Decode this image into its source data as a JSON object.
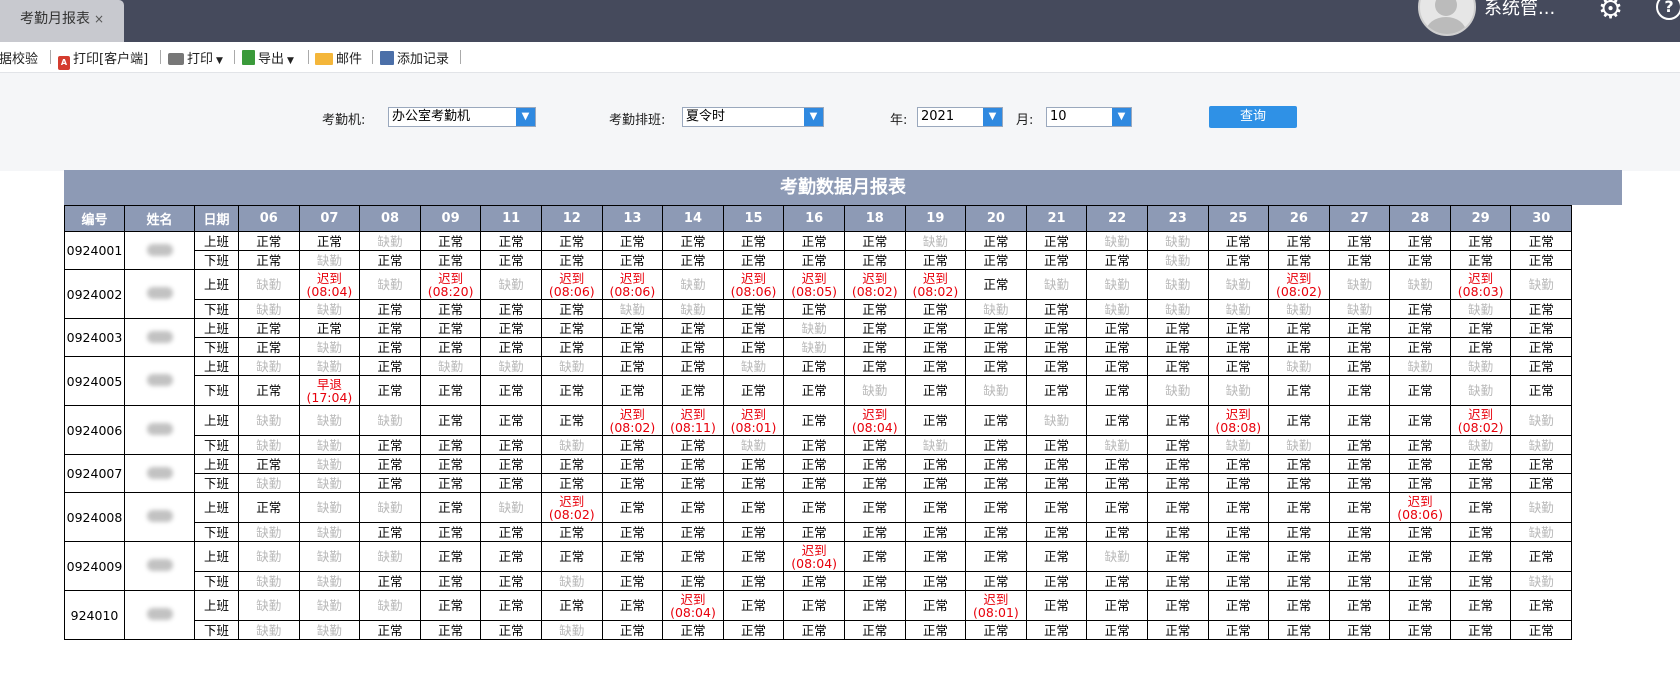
{
  "tab": {
    "title": "考勤月报表",
    "close": "×"
  },
  "user": {
    "name": "系统管..."
  },
  "toolbar": {
    "items": [
      "数据校验",
      "打印[客户端]",
      "打印",
      "导出",
      "邮件",
      "添加记录"
    ]
  },
  "filters": {
    "machine_label": "考勤机:",
    "machine_value": "办公室考勤机",
    "shift_label": "考勤排班:",
    "shift_value": "夏令时",
    "year_label": "年:",
    "year_value": "2021",
    "month_label": "月:",
    "month_value": "10",
    "query_button": "查询"
  },
  "report": {
    "title": "考勤数据月报表",
    "headers": {
      "id": "编号",
      "name": "姓名",
      "date": "日期"
    },
    "days": [
      "06",
      "07",
      "08",
      "09",
      "11",
      "12",
      "13",
      "14",
      "15",
      "16",
      "18",
      "19",
      "20",
      "21",
      "22",
      "23",
      "25",
      "26",
      "27",
      "28",
      "29",
      "30"
    ],
    "labels": {
      "in": "上班",
      "out": "下班"
    },
    "status_text": {
      "N": "正常",
      "A": "缺勤",
      "L": "迟到",
      "E": "早退"
    },
    "employees": [
      {
        "id": "0924001",
        "in": [
          "N",
          "N",
          "A",
          "N",
          "N",
          "N",
          "N",
          "N",
          "N",
          "N",
          "N",
          "A",
          "N",
          "N",
          "A",
          "A",
          "N",
          "N",
          "N",
          "N",
          "N",
          "N"
        ],
        "out": [
          "N",
          "A",
          "N",
          "N",
          "N",
          "N",
          "N",
          "N",
          "N",
          "N",
          "N",
          "N",
          "N",
          "N",
          "N",
          "A",
          "N",
          "N",
          "N",
          "N",
          "N",
          "N"
        ]
      },
      {
        "id": "0924002",
        "in": [
          "A",
          "L:08:04",
          "A",
          "L:08:20",
          "A",
          "L:08:06",
          "L:08:06",
          "A",
          "L:08:06",
          "L:08:05",
          "L:08:02",
          "L:08:02",
          "N",
          "A",
          "A",
          "A",
          "A",
          "L:08:02",
          "A",
          "A",
          "L:08:03",
          "A"
        ],
        "out": [
          "A",
          "A",
          "N",
          "N",
          "N",
          "N",
          "A",
          "A",
          "N",
          "N",
          "N",
          "N",
          "A",
          "N",
          "A",
          "A",
          "A",
          "A",
          "A",
          "N",
          "A",
          "N"
        ]
      },
      {
        "id": "0924003",
        "in": [
          "N",
          "N",
          "N",
          "N",
          "N",
          "N",
          "N",
          "N",
          "N",
          "A",
          "N",
          "N",
          "N",
          "N",
          "N",
          "N",
          "N",
          "N",
          "N",
          "N",
          "N",
          "N"
        ],
        "out": [
          "N",
          "A",
          "N",
          "N",
          "N",
          "N",
          "N",
          "N",
          "N",
          "A",
          "N",
          "N",
          "N",
          "N",
          "N",
          "N",
          "N",
          "N",
          "N",
          "N",
          "N",
          "N"
        ]
      },
      {
        "id": "0924005",
        "in": [
          "A",
          "A",
          "N",
          "A",
          "A",
          "A",
          "N",
          "N",
          "A",
          "N",
          "N",
          "N",
          "N",
          "N",
          "N",
          "N",
          "N",
          "A",
          "N",
          "A",
          "A",
          "N"
        ],
        "out": [
          "N",
          "E:17:04",
          "N",
          "N",
          "N",
          "N",
          "N",
          "N",
          "N",
          "N",
          "A",
          "N",
          "A",
          "N",
          "N",
          "A",
          "A",
          "N",
          "N",
          "N",
          "A",
          "N"
        ]
      },
      {
        "id": "0924006",
        "in": [
          "A",
          "A",
          "A",
          "N",
          "N",
          "N",
          "L:08:02",
          "L:08:11",
          "L:08:01",
          "N",
          "L:08:04",
          "N",
          "N",
          "A",
          "N",
          "N",
          "L:08:08",
          "N",
          "N",
          "N",
          "L:08:02",
          "A"
        ],
        "out": [
          "A",
          "A",
          "N",
          "N",
          "N",
          "A",
          "N",
          "N",
          "A",
          "N",
          "N",
          "A",
          "N",
          "N",
          "A",
          "N",
          "A",
          "A",
          "N",
          "N",
          "A",
          "A"
        ]
      },
      {
        "id": "0924007",
        "in": [
          "N",
          "A",
          "N",
          "N",
          "N",
          "N",
          "N",
          "N",
          "N",
          "N",
          "N",
          "N",
          "N",
          "N",
          "N",
          "N",
          "N",
          "N",
          "N",
          "N",
          "N",
          "N"
        ],
        "out": [
          "A",
          "A",
          "N",
          "N",
          "N",
          "N",
          "N",
          "N",
          "N",
          "N",
          "N",
          "N",
          "N",
          "N",
          "N",
          "N",
          "N",
          "N",
          "N",
          "N",
          "N",
          "N"
        ]
      },
      {
        "id": "0924008",
        "in": [
          "N",
          "A",
          "A",
          "N",
          "A",
          "L:08:02",
          "N",
          "N",
          "N",
          "N",
          "N",
          "N",
          "N",
          "N",
          "N",
          "N",
          "N",
          "N",
          "N",
          "L:08:06",
          "N",
          "A"
        ],
        "out": [
          "A",
          "A",
          "N",
          "N",
          "N",
          "N",
          "N",
          "N",
          "N",
          "N",
          "N",
          "N",
          "N",
          "N",
          "N",
          "N",
          "N",
          "N",
          "N",
          "N",
          "N",
          "A"
        ]
      },
      {
        "id": "0924009",
        "in": [
          "A",
          "A",
          "A",
          "N",
          "N",
          "N",
          "N",
          "N",
          "N",
          "L:08:04",
          "N",
          "N",
          "N",
          "N",
          "A",
          "N",
          "N",
          "N",
          "N",
          "N",
          "N",
          "N"
        ],
        "out": [
          "A",
          "A",
          "N",
          "N",
          "N",
          "A",
          "N",
          "N",
          "N",
          "N",
          "N",
          "N",
          "N",
          "N",
          "N",
          "N",
          "N",
          "N",
          "N",
          "N",
          "N",
          "A"
        ]
      },
      {
        "id": "924010",
        "in": [
          "A",
          "A",
          "A",
          "N",
          "N",
          "N",
          "N",
          "L:08:04",
          "N",
          "N",
          "N",
          "N",
          "L:08:01",
          "N",
          "N",
          "N",
          "N",
          "N",
          "N",
          "N",
          "N",
          "N"
        ],
        "out": [
          "A",
          "A",
          "N",
          "N",
          "N",
          "A",
          "N",
          "N",
          "N",
          "N",
          "N",
          "N",
          "N",
          "N",
          "N",
          "N",
          "N",
          "N",
          "N",
          "N",
          "N",
          "N"
        ]
      }
    ]
  }
}
